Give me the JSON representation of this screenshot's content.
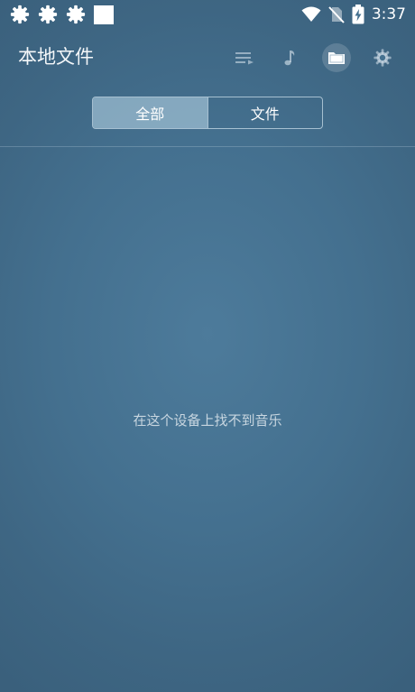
{
  "status_bar": {
    "time": "3:37",
    "notification_icons": [
      "gear-icon",
      "gear-icon",
      "gear-icon",
      "square-icon"
    ],
    "system_icons": [
      "wifi-icon",
      "no-sim-icon",
      "battery-charging-icon"
    ]
  },
  "app_bar": {
    "title": "本地文件",
    "actions": [
      {
        "icon": "playlist-icon",
        "selected": false
      },
      {
        "icon": "music-note-icon",
        "selected": false
      },
      {
        "icon": "folder-icon",
        "selected": true
      },
      {
        "icon": "settings-icon",
        "selected": false
      }
    ]
  },
  "tabs": {
    "items": [
      {
        "label": "全部",
        "active": true
      },
      {
        "label": "文件",
        "active": false
      }
    ]
  },
  "empty_state": {
    "message": "在这个设备上找不到音乐"
  },
  "colors": {
    "background": "#44708f",
    "active_tab": "#9fbdd0",
    "text_muted": "#c8d6e0"
  }
}
